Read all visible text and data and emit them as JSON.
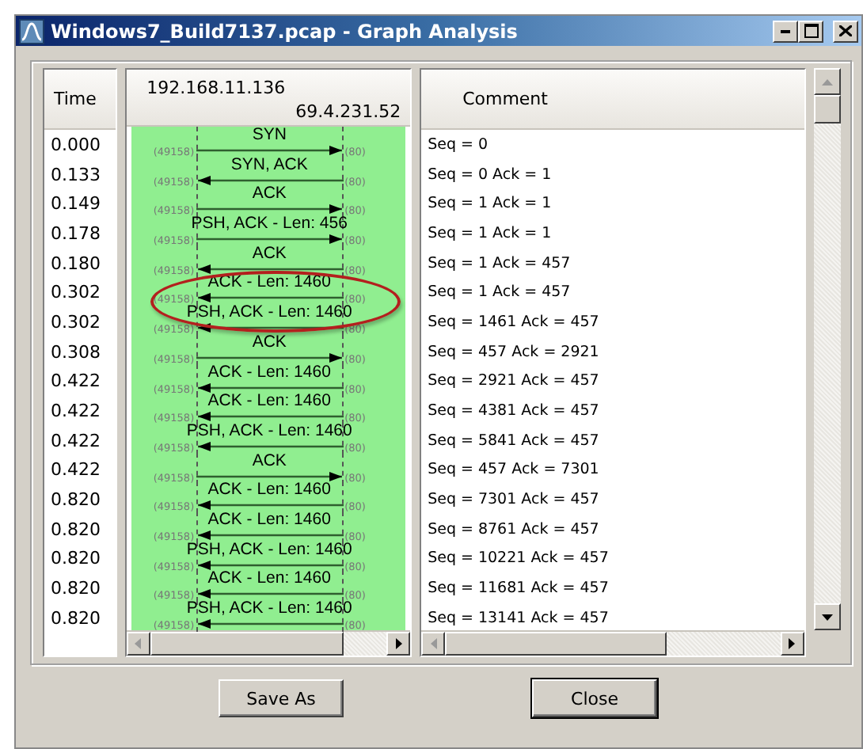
{
  "window": {
    "title": "Windows7_Build7137.pcap - Graph Analysis"
  },
  "columns": {
    "time": "Time",
    "host_a": "192.168.11.136",
    "host_b": "69.4.231.52",
    "comment": "Comment"
  },
  "rows": [
    {
      "time": "0.000",
      "label": "SYN",
      "kind": "right",
      "src_port": "(49158)",
      "dst_port": "(80)",
      "comment": "Seq = 0",
      "circled": false
    },
    {
      "time": "0.133",
      "label": "SYN, ACK",
      "kind": "left",
      "src_port": "(49158)",
      "dst_port": "(80)",
      "comment": "Seq = 0 Ack = 1",
      "circled": false
    },
    {
      "time": "0.149",
      "label": "ACK",
      "kind": "right",
      "src_port": "(49158)",
      "dst_port": "(80)",
      "comment": "Seq = 1 Ack = 1",
      "circled": false
    },
    {
      "time": "0.178",
      "label": "PSH, ACK - Len: 456",
      "kind": "right",
      "src_port": "(49158)",
      "dst_port": "(80)",
      "comment": "Seq = 1 Ack = 1",
      "circled": false
    },
    {
      "time": "0.180",
      "label": "ACK",
      "kind": "left",
      "src_port": "(49158)",
      "dst_port": "(80)",
      "comment": "Seq = 1 Ack = 457",
      "circled": false
    },
    {
      "time": "0.302",
      "label": "ACK - Len: 1460",
      "kind": "left",
      "src_port": "(49158)",
      "dst_port": "(80)",
      "comment": "Seq = 1 Ack = 457",
      "circled": true
    },
    {
      "time": "0.302",
      "label": "PSH, ACK - Len: 1460",
      "kind": "left",
      "src_port": "(49158)",
      "dst_port": "(80)",
      "comment": "Seq = 1461 Ack = 457",
      "circled": true
    },
    {
      "time": "0.308",
      "label": "ACK",
      "kind": "right",
      "src_port": "(49158)",
      "dst_port": "(80)",
      "comment": "Seq = 457 Ack = 2921",
      "circled": false
    },
    {
      "time": "0.422",
      "label": "ACK - Len: 1460",
      "kind": "left",
      "src_port": "(49158)",
      "dst_port": "(80)",
      "comment": "Seq = 2921 Ack = 457",
      "circled": false
    },
    {
      "time": "0.422",
      "label": "ACK - Len: 1460",
      "kind": "left",
      "src_port": "(49158)",
      "dst_port": "(80)",
      "comment": "Seq = 4381 Ack = 457",
      "circled": false
    },
    {
      "time": "0.422",
      "label": "PSH, ACK - Len: 1460",
      "kind": "left",
      "src_port": "(49158)",
      "dst_port": "(80)",
      "comment": "Seq = 5841 Ack = 457",
      "circled": false
    },
    {
      "time": "0.422",
      "label": "ACK",
      "kind": "right",
      "src_port": "(49158)",
      "dst_port": "(80)",
      "comment": "Seq = 457 Ack = 7301",
      "circled": false
    },
    {
      "time": "0.820",
      "label": "ACK - Len: 1460",
      "kind": "left",
      "src_port": "(49158)",
      "dst_port": "(80)",
      "comment": "Seq = 7301 Ack = 457",
      "circled": false
    },
    {
      "time": "0.820",
      "label": "ACK - Len: 1460",
      "kind": "left",
      "src_port": "(49158)",
      "dst_port": "(80)",
      "comment": "Seq = 8761 Ack = 457",
      "circled": false
    },
    {
      "time": "0.820",
      "label": "PSH, ACK - Len: 1460",
      "kind": "left",
      "src_port": "(49158)",
      "dst_port": "(80)",
      "comment": "Seq = 10221 Ack = 457",
      "circled": false
    },
    {
      "time": "0.820",
      "label": "ACK - Len: 1460",
      "kind": "left",
      "src_port": "(49158)",
      "dst_port": "(80)",
      "comment": "Seq = 11681 Ack = 457",
      "circled": false
    },
    {
      "time": "0.820",
      "label": "PSH, ACK - Len: 1460",
      "kind": "left",
      "src_port": "(49158)",
      "dst_port": "(80)",
      "comment": "Seq = 13141 Ack = 457",
      "circled": false
    }
  ],
  "buttons": [
    "Save As",
    "Close"
  ]
}
